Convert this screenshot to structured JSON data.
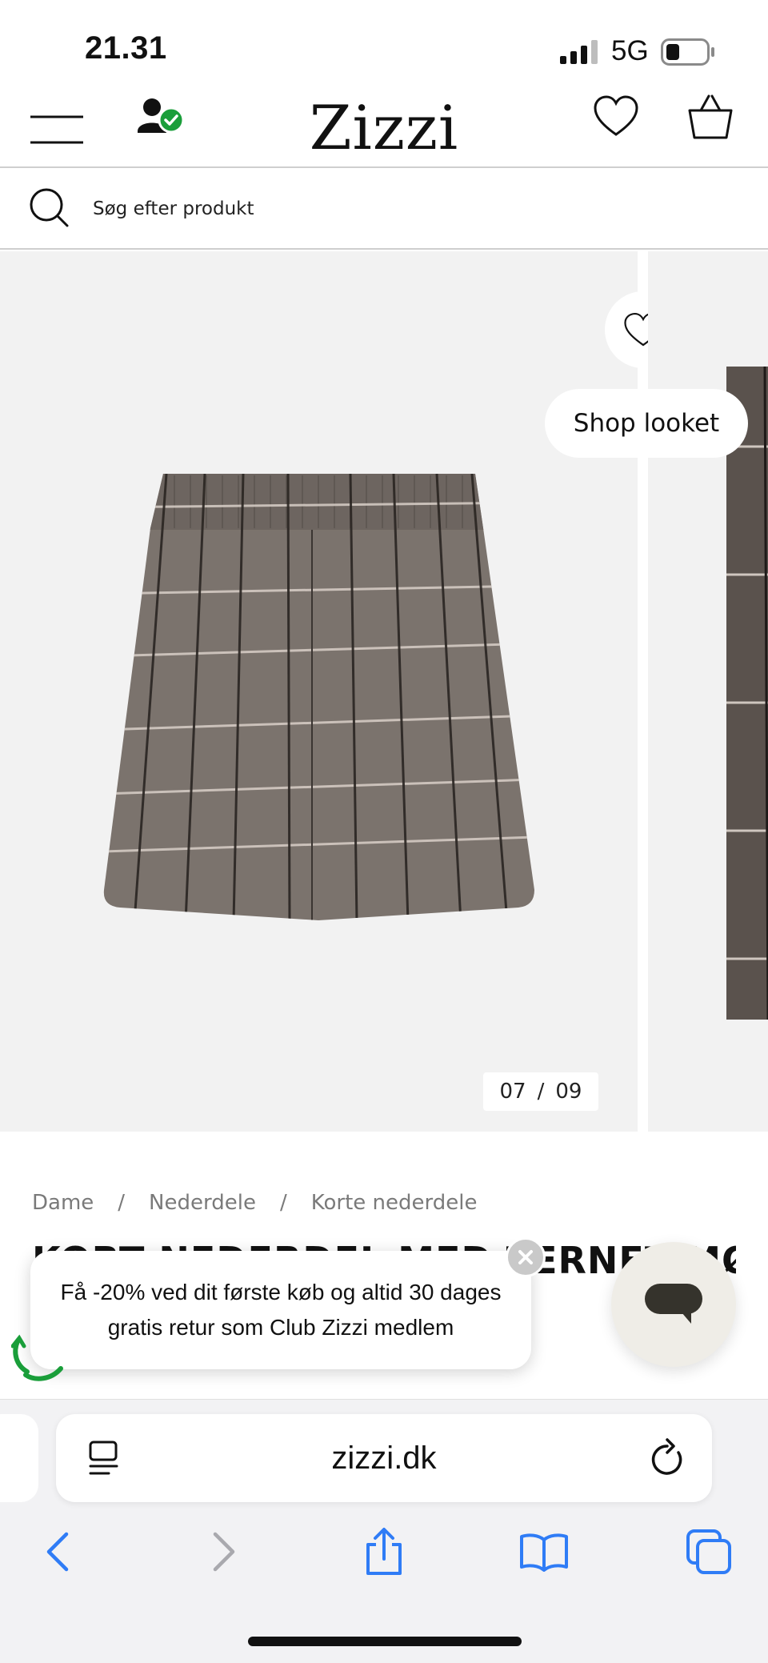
{
  "status_bar": {
    "time": "21.31",
    "network": "5G",
    "icons": [
      "signal-icon",
      "battery-icon"
    ]
  },
  "header": {
    "logo": "Zizzi",
    "icons": [
      "menu-icon",
      "user-verified-icon",
      "heart-icon",
      "shopping-bag-icon"
    ],
    "colors": {
      "verified_badge": "#1a9e3a"
    }
  },
  "search": {
    "placeholder": "Søg efter produkt"
  },
  "gallery": {
    "shop_look_label": "Shop looket",
    "current": "07",
    "separator": "/",
    "total": "09"
  },
  "breadcrumb": {
    "items": [
      "Dame",
      "Nederdele",
      "Korte nederdele"
    ],
    "separator": "/"
  },
  "product": {
    "title": "KORT NEDERDEL MED TERNET MØNSTER"
  },
  "promo": {
    "text": "Få -20% ved dit første køb og altid 30 dages gratis retur som Club Zizzi medlem"
  },
  "browser": {
    "url": "zizzi.dk",
    "colors": {
      "accent": "#2f7cf6"
    }
  }
}
